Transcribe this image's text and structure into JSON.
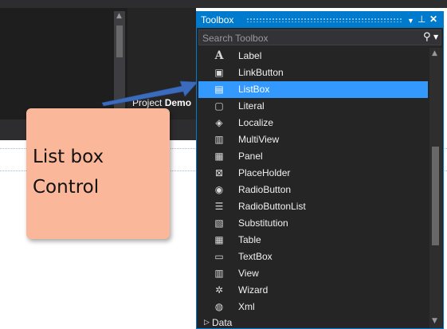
{
  "background": {
    "project_prefix": "Project ",
    "project_name": "Demo"
  },
  "note": {
    "line1": "List box",
    "line2": "Control",
    "color": "#fbb799"
  },
  "arrow": {
    "color": "#3b6bbd"
  },
  "toolbox": {
    "title": "Toolbox",
    "accent": "#007acc",
    "search_placeholder": "Search Toolbox",
    "selected_color": "#3399ff",
    "items": [
      {
        "label": "Label",
        "icon": "label-icon",
        "glyph": "A"
      },
      {
        "label": "LinkButton",
        "icon": "linkbutton-icon",
        "glyph": "▣"
      },
      {
        "label": "ListBox",
        "icon": "listbox-icon",
        "glyph": "▤",
        "selected": true
      },
      {
        "label": "Literal",
        "icon": "literal-icon",
        "glyph": "▢"
      },
      {
        "label": "Localize",
        "icon": "localize-icon",
        "glyph": "◈"
      },
      {
        "label": "MultiView",
        "icon": "multiview-icon",
        "glyph": "▥"
      },
      {
        "label": "Panel",
        "icon": "panel-icon",
        "glyph": "▦"
      },
      {
        "label": "PlaceHolder",
        "icon": "placeholder-icon",
        "glyph": "⊠"
      },
      {
        "label": "RadioButton",
        "icon": "radiobutton-icon",
        "glyph": "◉"
      },
      {
        "label": "RadioButtonList",
        "icon": "radiobuttonlist-icon",
        "glyph": "☰"
      },
      {
        "label": "Substitution",
        "icon": "substitution-icon",
        "glyph": "▧"
      },
      {
        "label": "Table",
        "icon": "table-icon",
        "glyph": "▦"
      },
      {
        "label": "TextBox",
        "icon": "textbox-icon",
        "glyph": "▭"
      },
      {
        "label": "View",
        "icon": "view-icon",
        "glyph": "▥"
      },
      {
        "label": "Wizard",
        "icon": "wizard-icon",
        "glyph": "✲"
      },
      {
        "label": "Xml",
        "icon": "xml-icon",
        "glyph": "◍"
      }
    ],
    "next_group": "Data"
  }
}
